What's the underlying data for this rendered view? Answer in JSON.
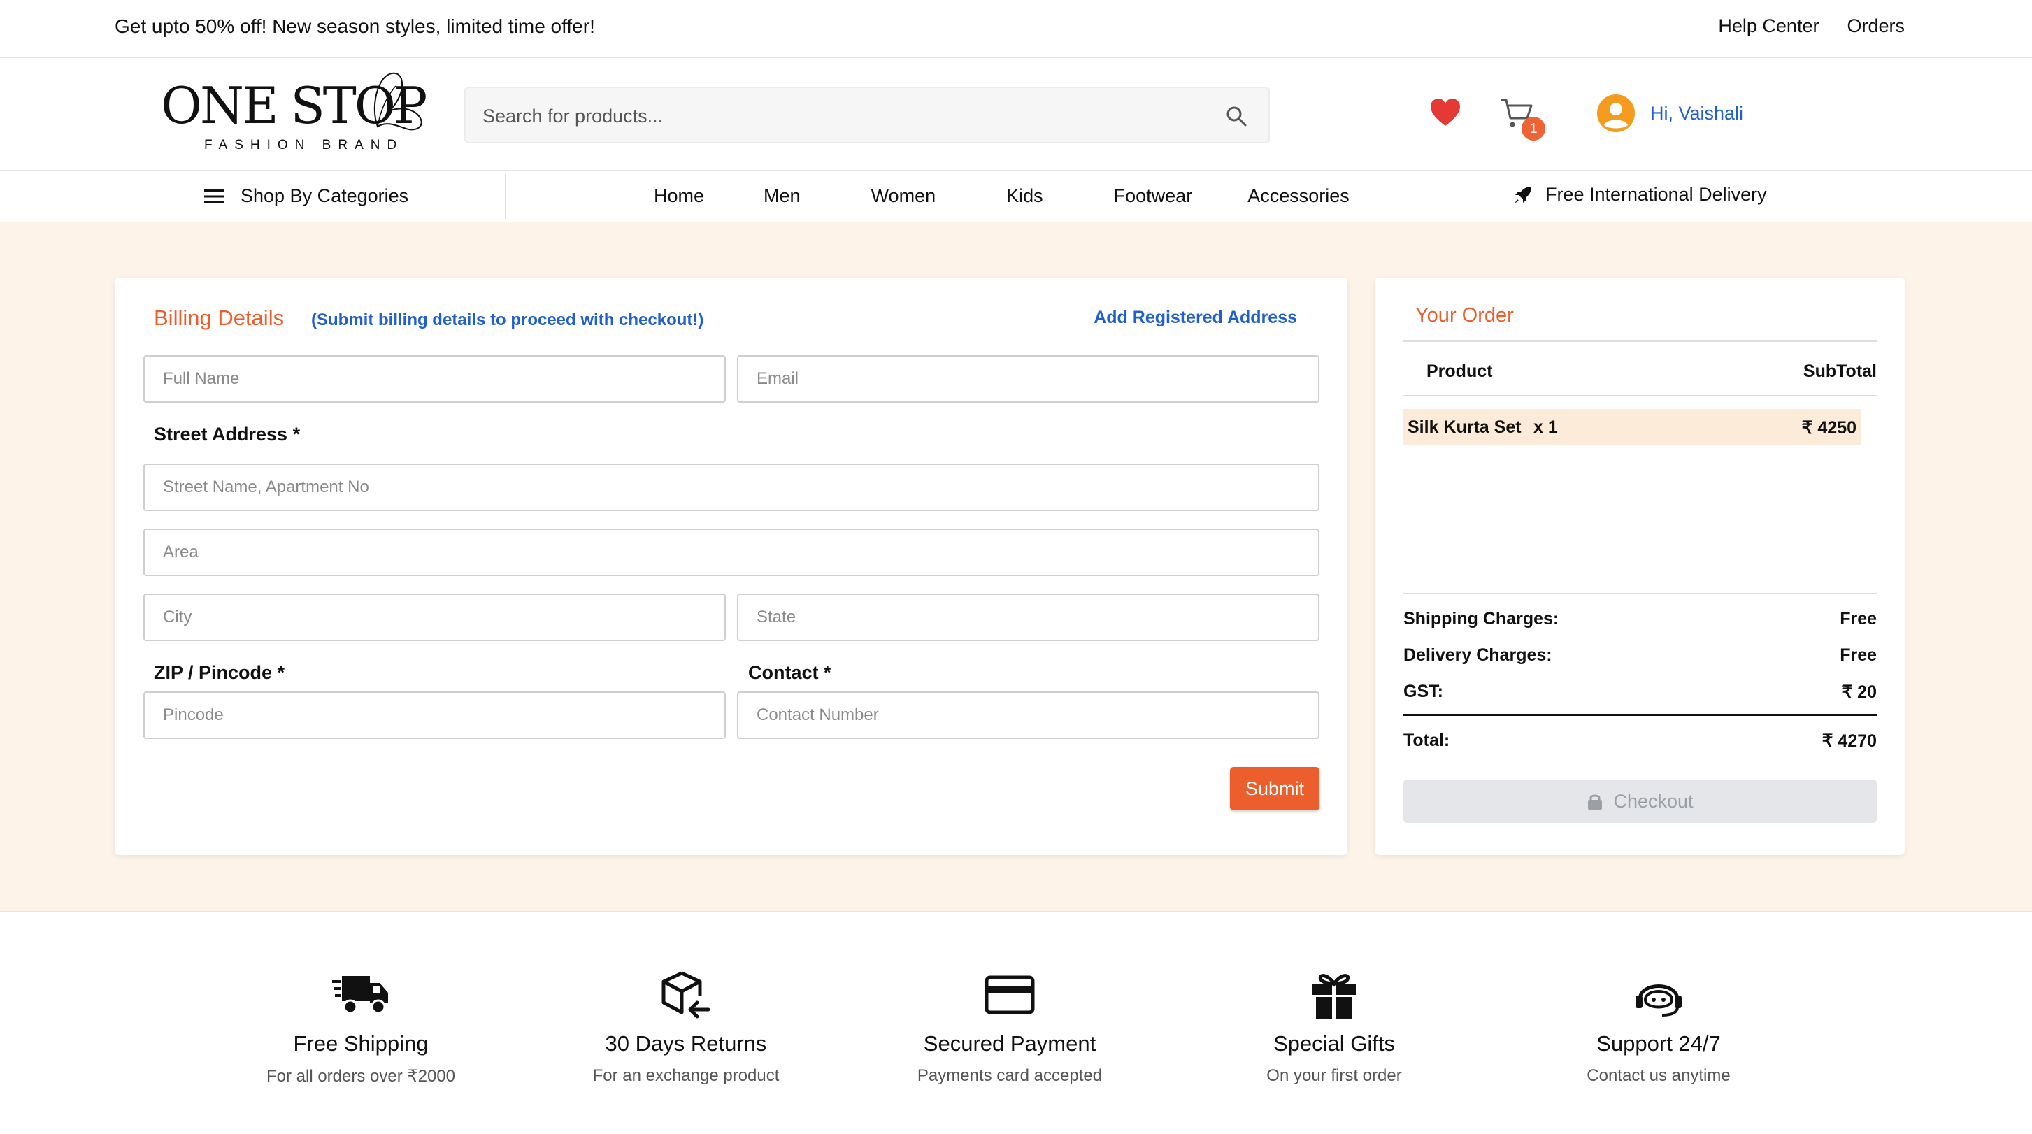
{
  "topbar": {
    "promo": "Get upto 50% off! New season styles, limited time offer!",
    "help": "Help Center",
    "orders": "Orders"
  },
  "logo": {
    "word": "ONE STOP",
    "sub": "FASHION BRAND"
  },
  "search": {
    "placeholder": "Search for products..."
  },
  "cart": {
    "count": "1"
  },
  "user": {
    "greeting": "Hi, Vaishali"
  },
  "nav": {
    "categories": "Shop By Categories",
    "items": [
      "Home",
      "Men",
      "Women",
      "Kids",
      "Footwear",
      "Accessories"
    ],
    "delivery": "Free International Delivery"
  },
  "billing": {
    "title": "Billing Details",
    "hint": "(Submit billing details to proceed with checkout!)",
    "add_registered": "Add Registered Address",
    "fullname_ph": "Full Name",
    "email_ph": "Email",
    "street_label": "Street Address *",
    "street_ph": "Street Name, Apartment No",
    "area_ph": "Area",
    "city_ph": "City",
    "state_ph": "State",
    "zip_label": "ZIP / Pincode *",
    "contact_label": "Contact *",
    "pincode_ph": "Pincode",
    "contact_ph": "Contact Number",
    "submit": "Submit"
  },
  "order": {
    "title": "Your Order",
    "col_product": "Product",
    "col_subtotal": "SubTotal",
    "items": [
      {
        "name": "Silk Kurta Set",
        "qty": "x 1",
        "price": "₹ 4250"
      }
    ],
    "shipping_label": "Shipping Charges:",
    "shipping_value": "Free",
    "delivery_label": "Delivery Charges:",
    "delivery_value": "Free",
    "gst_label": "GST:",
    "gst_value": "₹ 20",
    "total_label": "Total:",
    "total_value": "₹ 4270",
    "checkout": "Checkout"
  },
  "features": [
    {
      "icon": "truck-icon",
      "title": "Free Shipping",
      "sub": "For all orders over ₹2000"
    },
    {
      "icon": "box-return-icon",
      "title": "30 Days Returns",
      "sub": "For an exchange product"
    },
    {
      "icon": "credit-card-icon",
      "title": "Secured Payment",
      "sub": "Payments card accepted"
    },
    {
      "icon": "gift-icon",
      "title": "Special Gifts",
      "sub": "On your first order"
    },
    {
      "icon": "headset-icon",
      "title": "Support 24/7",
      "sub": "Contact us anytime"
    }
  ],
  "colors": {
    "accent": "#ec5e2c",
    "link": "#1f5fd1",
    "background": "#fdf3e8"
  }
}
